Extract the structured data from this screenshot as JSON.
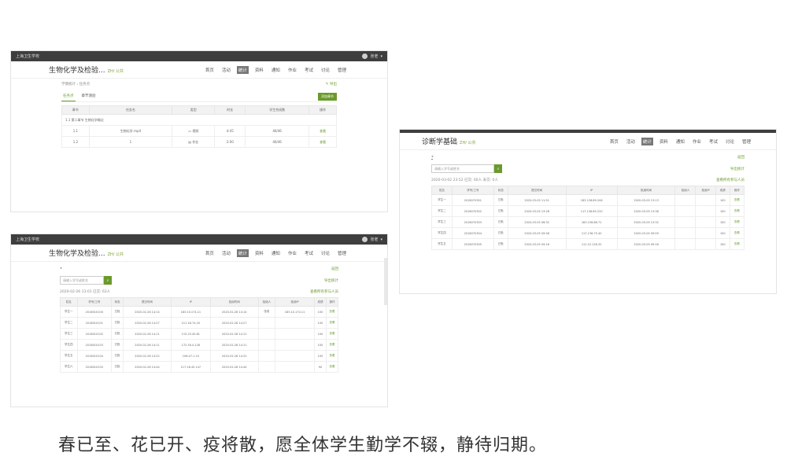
{
  "caption": "春已至、花已开、疫将散，愿全体学生勤学不辍，静待归期。",
  "common": {
    "school": "上海卫生学校",
    "user": "张老",
    "tag": "ZH/ 公共",
    "nav": [
      "首页",
      "活动",
      "统计",
      "资料",
      "通知",
      "作业",
      "考试",
      "讨论",
      "管理"
    ]
  },
  "shot1": {
    "course": "生物化学及检验...",
    "crumb": "学情统计 › 任务点",
    "export": "导出",
    "tabs": [
      "任务点",
      "章节测验"
    ],
    "button": "添加章节",
    "columns": [
      "章节",
      "任务名",
      "类型",
      "时长",
      "学生完成数",
      "操作"
    ],
    "section": "1.1 第二章节 生物化学概论",
    "rows": [
      {
        "ch": "1.1",
        "name": "生物化学.mp4",
        "type": "视频",
        "dur": "4:45",
        "done": "46/46",
        "op": "查看"
      },
      {
        "ch": "1.2",
        "name": "1",
        "type": "作业",
        "dur": "2:00",
        "done": "46/46",
        "op": "查看"
      }
    ]
  },
  "shot2": {
    "course": "生物化学及检验...",
    "back": "返回",
    "search_placeholder": "请输入学号或姓名",
    "export": "导出统计",
    "meta_time": "2020-02-26 13:01",
    "meta_stats": "已交: 63人",
    "link": "查看所有参与人员",
    "columns": [
      "姓名",
      "学号/工号",
      "状态",
      "提交时间",
      "IP",
      "批阅时间",
      "批阅人",
      "批阅IP",
      "成绩",
      "操作"
    ],
    "rows": [
      {
        "name": "学生一",
        "id": "2018010100",
        "st": "已批",
        "sub": "2020-02-26 14:14",
        "ip": "183.10.174.11",
        "rt": "2020-02-26 14:14",
        "by": "张老",
        "rip": "183.10.174.11",
        "sc": "100",
        "op": "查看"
      },
      {
        "name": "学生二",
        "id": "2018010101",
        "st": "已批",
        "sub": "2020-02-26 14:27",
        "ip": "211.16.74.20",
        "rt": "2020-02-26 14:27",
        "by": "",
        "rip": "",
        "sc": "100",
        "op": "查看"
      },
      {
        "name": "学生三",
        "id": "2018010102",
        "st": "已批",
        "sub": "2020-02-26 14:11",
        "ip": "115.23.45.61",
        "rt": "2020-02-26 14:11",
        "by": "",
        "rip": "",
        "sc": "100",
        "op": "查看"
      },
      {
        "name": "学生四",
        "id": "2018010103",
        "st": "已批",
        "sub": "2020-02-26 14:11",
        "ip": "172.16.4.128",
        "rt": "2020-02-26 14:11",
        "by": "",
        "rip": "",
        "sc": "100",
        "op": "查看"
      },
      {
        "name": "学生五",
        "id": "2018010104",
        "st": "已批",
        "sub": "2020-02-26 14:22",
        "ip": "106.47.1.10",
        "rt": "2020-02-26 14:22",
        "by": "",
        "rip": "",
        "sc": "100",
        "op": "查看"
      },
      {
        "name": "学生六",
        "id": "2018010105",
        "st": "已批",
        "sub": "2020-02-26 14:44",
        "ip": "117.16.45.147",
        "rt": "2020-02-26 14:44",
        "by": "",
        "rip": "",
        "sc": "90",
        "op": "查看"
      }
    ]
  },
  "shot3": {
    "course": "诊断学基础",
    "back": "返回",
    "search_placeholder": "请输入学号或姓名",
    "export": "导出统计",
    "meta_time": "2020-03-02 23:52",
    "meta_stats": "已交: 60人  未交: 0人",
    "link": "查看所有参与人员",
    "columns": [
      "姓名",
      "学号/工号",
      "状态",
      "提交时间",
      "IP",
      "批阅时间",
      "批阅人",
      "批阅IP",
      "成绩",
      "操作"
    ],
    "rows": [
      {
        "name": "学生一",
        "id": "2018070301",
        "st": "已批",
        "sub": "2020-03-05 11:51",
        "ip": "183.128.89.206",
        "rt": "2020-03-05 13:13",
        "by": "",
        "rip": "",
        "sc": "100",
        "op": "查看"
      },
      {
        "name": "学生二",
        "id": "2018070302",
        "st": "已批",
        "sub": "2020-03-05 13:28",
        "ip": "117.136.65.220",
        "rt": "2020-03-05 13:38",
        "by": "",
        "rip": "",
        "sc": "100",
        "op": "查看"
      },
      {
        "name": "学生三",
        "id": "2018070303",
        "st": "已批",
        "sub": "2020-03-05 06:32",
        "ip": "183.156.88.71",
        "rt": "2020-03-05 13:32",
        "by": "",
        "rip": "",
        "sc": "100",
        "op": "查看"
      },
      {
        "name": "学生四",
        "id": "2018070304",
        "st": "已批",
        "sub": "2020-03-05 09:56",
        "ip": "117.136.75.40",
        "rt": "2020-03-05 09:59",
        "by": "",
        "rip": "",
        "sc": "100",
        "op": "查看"
      },
      {
        "name": "学生五",
        "id": "2018070305",
        "st": "已批",
        "sub": "2020-03-05 09:16",
        "ip": "111.22.126.32",
        "rt": "2020-03-05 09:16",
        "by": "",
        "rip": "",
        "sc": "100",
        "op": "查看"
      }
    ]
  }
}
